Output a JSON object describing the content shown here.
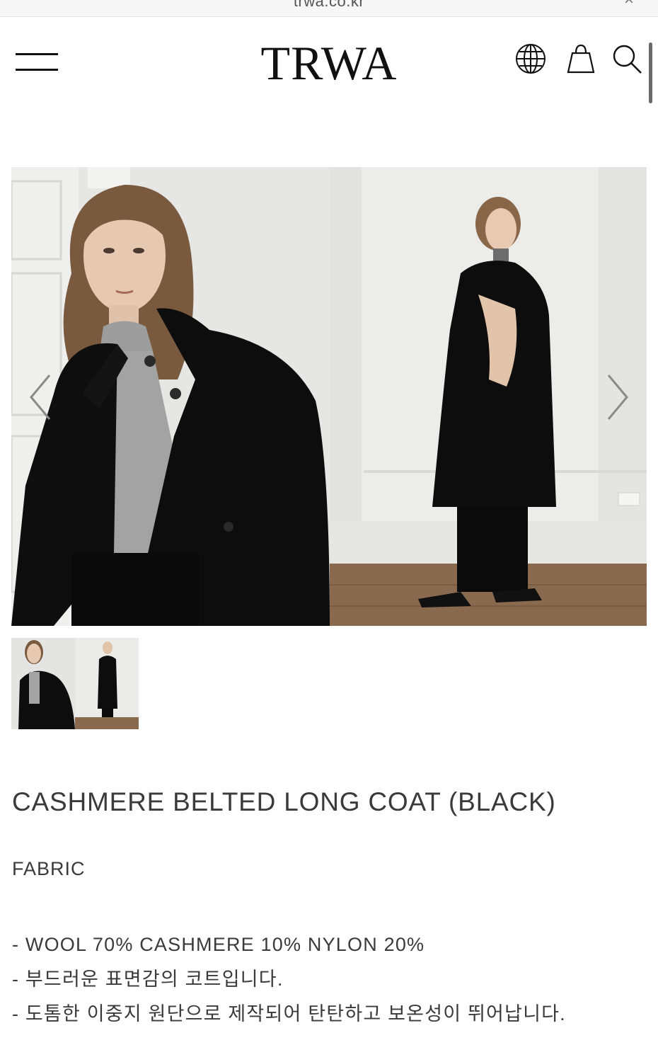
{
  "browser": {
    "url": "trwa.co.kr",
    "close_glyph": "×"
  },
  "header": {
    "logo": "TRWA",
    "icons": [
      "menu-icon",
      "globe-icon",
      "shopping-bag-icon",
      "search-icon"
    ]
  },
  "gallery": {
    "prev_glyph": "‹",
    "next_glyph": "›",
    "images": [
      "model-closeup-photo",
      "model-full-length-photo"
    ]
  },
  "product": {
    "title": "CASHMERE BELTED LONG COAT (BLACK)",
    "section_label": "FABRIC",
    "details": [
      "- WOOL 70% CASHMERE 10% NYLON 20%",
      "- 부드러운 표면감의 코트입니다.",
      "- 도톰한 이중지 원단으로 제작되어 탄탄하고 보온성이 뛰어납니다."
    ]
  },
  "colors": {
    "text": "#3a3a3a",
    "logo": "#111111",
    "coat": "#0d0d0d",
    "floor": "#8a6a4f",
    "wall": "#e9e9e7"
  }
}
